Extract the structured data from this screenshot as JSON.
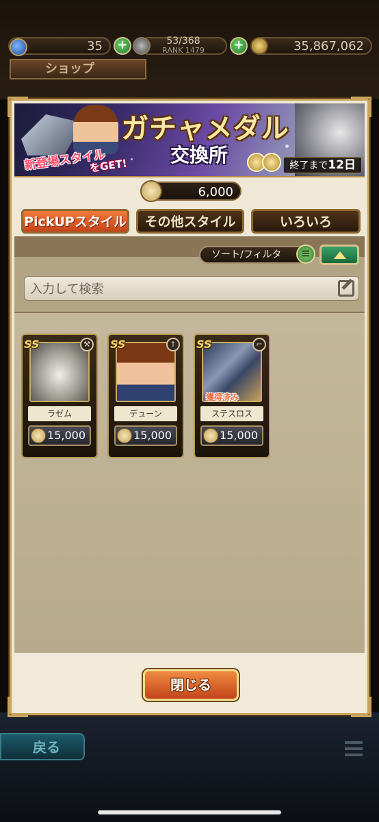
{
  "status": {
    "gems": "35",
    "stamina": "53/368",
    "rank": "RANK 1479",
    "gold": "35,867,062"
  },
  "shop_title": "ショップ",
  "banner": {
    "title": "ガチャメダル",
    "subtitle": "交換所",
    "new_style_line1": "新登場スタイル",
    "new_style_line2": "をGET!",
    "countdown_prefix": "終了まで",
    "countdown_days": "12日"
  },
  "currency": {
    "medals": "6,000"
  },
  "tabs": [
    {
      "label": "PickUPスタイル",
      "active": true
    },
    {
      "label": "その他スタイル",
      "active": false
    },
    {
      "label": "いろいろ",
      "active": false
    }
  ],
  "sort_filter": {
    "label": "ソート/フィルタ"
  },
  "search": {
    "placeholder": "入力して検索"
  },
  "items": [
    {
      "name": "ラゼム",
      "price": "15,000",
      "badge": "SS",
      "weapon_icon": "axe-icon",
      "acquired": false
    },
    {
      "name": "デューン",
      "price": "15,000",
      "badge": "SS",
      "weapon_icon": "sword-icon",
      "acquired": false
    },
    {
      "name": "ステスロス",
      "price": "15,000",
      "badge": "SS",
      "weapon_icon": "gun-icon",
      "acquired": true,
      "acquired_label": "獲得済み"
    }
  ],
  "close_button": "閉じる",
  "back_button": "戻る",
  "colors": {
    "accent_orange": "#e8622a",
    "frame_gold": "#c9a45c",
    "panel_bg": "#f0e8d6"
  }
}
